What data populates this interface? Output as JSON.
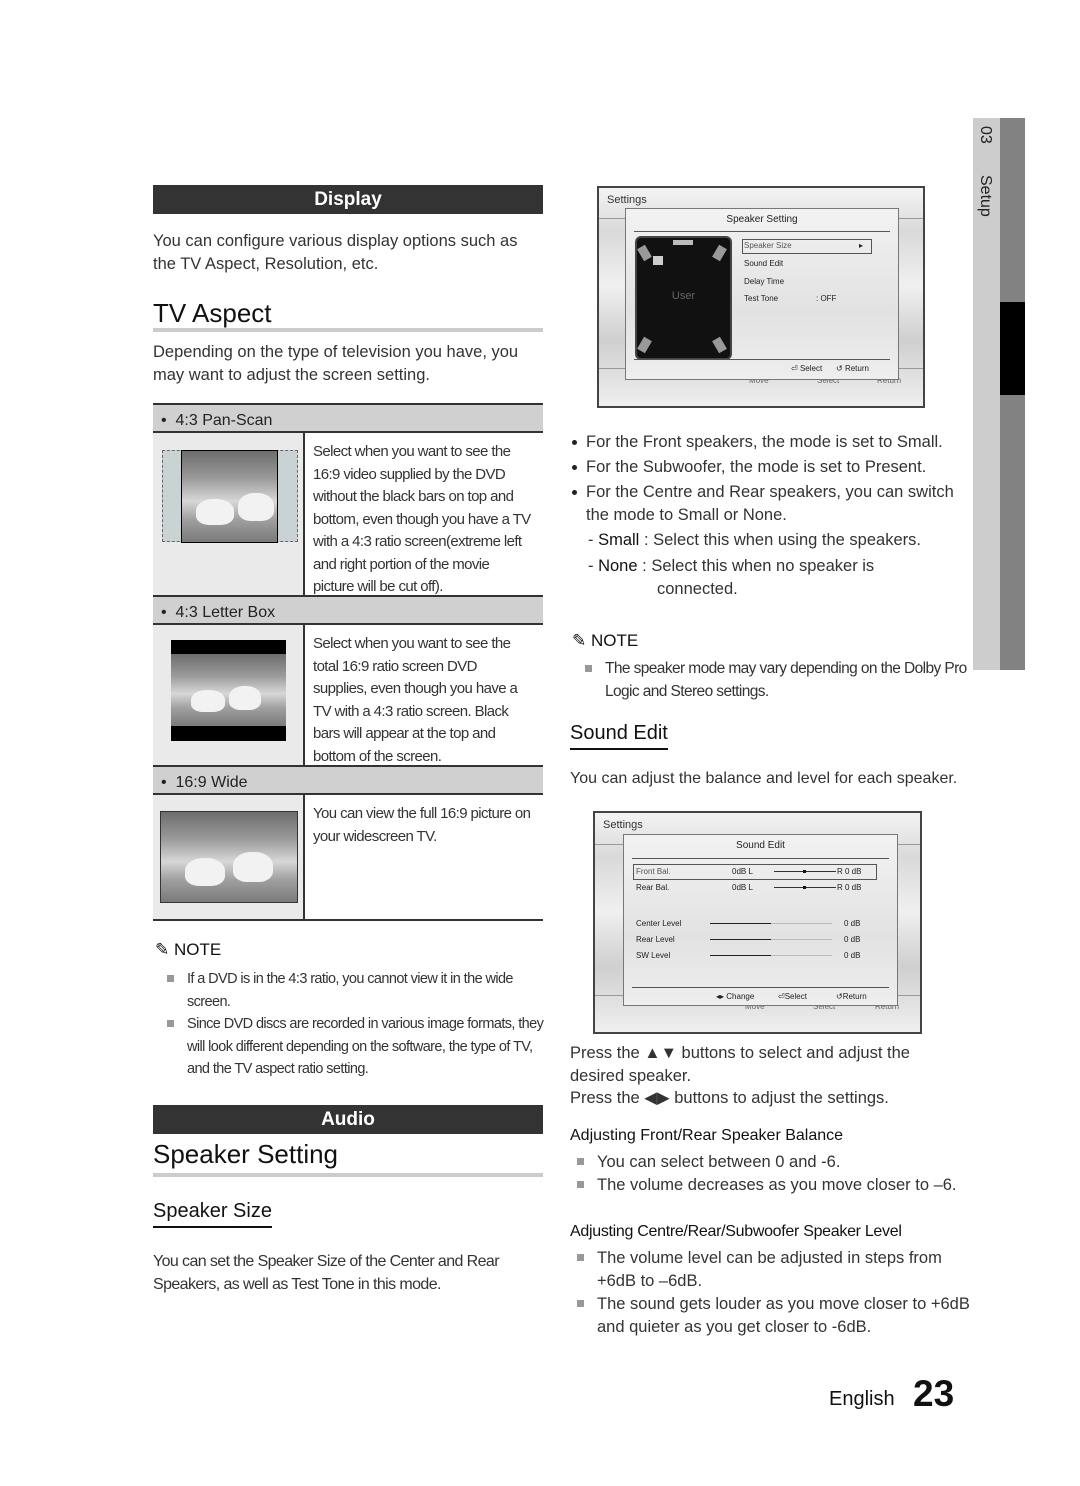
{
  "side_tab": {
    "chapter": "03",
    "label": "Setup"
  },
  "left": {
    "display_header": "Display",
    "display_intro": "You can configure various display options such as the TV Aspect, Resolution, etc.",
    "tv_aspect_title": "TV Aspect",
    "tv_aspect_intro": "Depending on the type of television you have, you may want to adjust the screen setting.",
    "aspect_options": [
      {
        "label": "4:3 Pan-Scan",
        "description": "Select when you want to see the 16:9 video supplied by the DVD without the black bars on top and bottom, even though you have a TV with a 4:3 ratio screen(extreme left and right portion of the movie picture will be cut off)."
      },
      {
        "label": "4:3 Letter Box",
        "description": "Select when you want to see the total 16:9 ratio screen DVD supplies, even though you have a TV with a 4:3 ratio screen. Black bars will appear at the top and bottom of the screen."
      },
      {
        "label": "16:9 Wide",
        "description": "You can view the full 16:9 picture on your widescreen TV."
      }
    ],
    "note_title": "NOTE",
    "notes": [
      "If a DVD is in the 4:3 ratio, you cannot view it in the wide screen.",
      "Since DVD discs are recorded in various image formats, they will look different depending on the software, the type of TV, and the TV aspect ratio setting."
    ],
    "audio_header": "Audio",
    "speaker_setting_title": "Speaker Setting",
    "speaker_size_title": "Speaker Size",
    "speaker_size_text": "You can set the Speaker Size of the Center and Rear Speakers, as well as Test Tone in this mode."
  },
  "osd_speaker": {
    "bg_title": "Settings",
    "dialog_title": "Speaker Setting",
    "layout_label": "User",
    "items": [
      {
        "label": "Speaker Size",
        "value": "▸",
        "selected": true
      },
      {
        "label": "Sound Edit",
        "value": ""
      },
      {
        "label": "Delay Time",
        "value": ""
      },
      {
        "label": "Test Tone",
        "value": ":  OFF"
      }
    ],
    "footer": {
      "select": "Select",
      "return": "Return"
    },
    "ghost_footer": {
      "move": "Move",
      "select": "Select",
      "return": "Return"
    }
  },
  "right": {
    "bullets": [
      "For the Front speakers, the mode is set to Small.",
      "For the Subwoofer, the mode is set to Present.",
      "For the Centre and Rear speakers, you can switch the mode to Small or None."
    ],
    "modes": [
      {
        "term": "Small",
        "sep": " :  ",
        "text": "Select this when using the speakers."
      },
      {
        "term": "None",
        "sep": " : ",
        "text": "Select this when no speaker is",
        "text2": "connected."
      }
    ],
    "note_title": "NOTE",
    "notes": [
      "The speaker mode may vary depending on the Dolby Pro Logic and Stereo settings."
    ],
    "sound_edit_title": "Sound Edit",
    "sound_edit_intro": "You can adjust the balance and level for each speaker.",
    "press_updown": "Press the ▲▼ buttons to select and adjust the desired speaker.",
    "press_leftright": "Press the ◀▶ buttons to adjust the settings.",
    "balance_title": "Adjusting Front/Rear Speaker Balance",
    "balance_notes": [
      "You can select between 0 and -6.",
      "The volume decreases as you move closer to –6."
    ],
    "level_title": "Adjusting Centre/Rear/Subwoofer Speaker Level",
    "level_notes": [
      "The volume level can be adjusted in steps from +6dB to –6dB.",
      "The sound gets louder as you move closer to +6dB and quieter as you get closer to -6dB."
    ]
  },
  "osd_sound": {
    "bg_title": "Settings",
    "dialog_title": "Sound Edit",
    "balance": [
      {
        "label": "Front  Bal.",
        "left": "0dB  L",
        "right": "R 0  dB",
        "position": 0.5,
        "selected": true
      },
      {
        "label": "Rear  Bal.",
        "left": "0dB  L",
        "right": "R 0  dB",
        "position": 0.5
      }
    ],
    "levels": [
      {
        "label": "Center  Level",
        "value": "0  dB",
        "level": 0.5
      },
      {
        "label": "Rear  Level",
        "value": "0  dB",
        "level": 0.5
      },
      {
        "label": "SW  Level",
        "value": "0  dB",
        "level": 0.5
      }
    ],
    "footer": {
      "change": "Change",
      "select": "Select",
      "return": "Return"
    },
    "ghost_footer": {
      "move": "Move",
      "select": "Select",
      "return": "Return"
    }
  },
  "footer": {
    "language": "English",
    "page": "23"
  }
}
